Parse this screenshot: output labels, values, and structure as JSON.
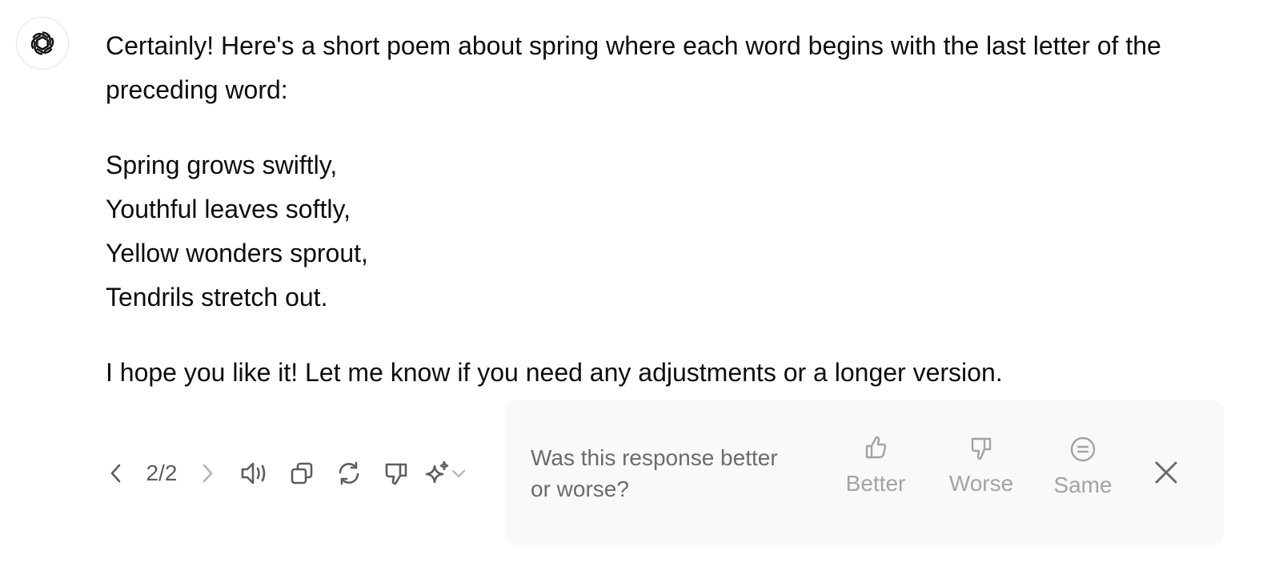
{
  "assistant": {
    "avatar_icon": "openai-logo-icon"
  },
  "message": {
    "intro": "Certainly! Here's a short poem about spring where each word begins with the last letter of the preceding word:",
    "poem_lines": [
      "Spring grows swiftly,",
      "Youthful leaves softly,",
      "Yellow wonders sprout,",
      "Tendrils stretch out."
    ],
    "closing": "I hope you like it! Let me know if you need any adjustments or a longer version."
  },
  "toolbar": {
    "pager": "2/2",
    "icons": [
      "chevron-left-icon",
      "chevron-right-icon",
      "speaker-icon",
      "copy-icon",
      "regenerate-icon",
      "thumbs-down-icon",
      "sparkle-icon",
      "chevron-down-icon"
    ]
  },
  "feedback": {
    "question": "Was this response better or worse?",
    "better_label": "Better",
    "worse_label": "Worse",
    "same_label": "Same",
    "icons": [
      "thumbs-up-icon",
      "thumbs-down-icon",
      "equal-icon",
      "close-icon"
    ]
  },
  "colors": {
    "text": "#0d0d0d",
    "muted_text": "#6b6b6b",
    "faded_text": "#a3a3a3",
    "panel_bg": "#f9f9f9",
    "icon": "#5d5d5d"
  }
}
